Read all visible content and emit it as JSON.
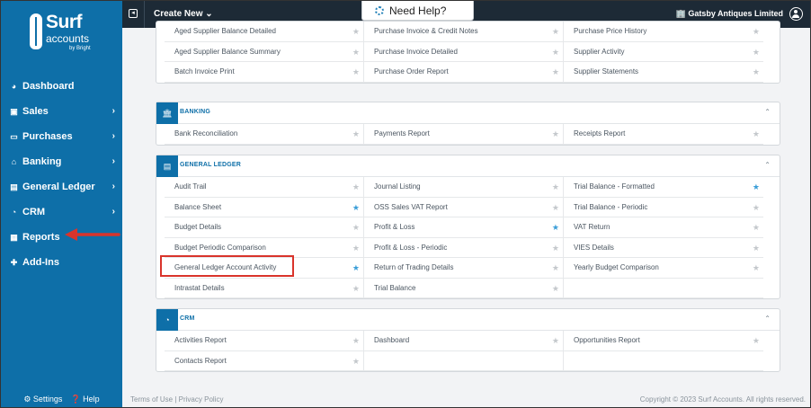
{
  "sidebar": {
    "logo": {
      "line1": "Surf",
      "line2": "accounts",
      "line3": "by Bright"
    },
    "items": [
      {
        "label": "Dashboard",
        "icon": "dashboard-icon",
        "glyph": "◕",
        "chevron": ""
      },
      {
        "label": "Sales",
        "icon": "briefcase-icon",
        "glyph": "▣",
        "chevron": "›"
      },
      {
        "label": "Purchases",
        "icon": "card-icon",
        "glyph": "▭",
        "chevron": "›"
      },
      {
        "label": "Banking",
        "icon": "bank-icon",
        "glyph": "⌂",
        "chevron": "›"
      },
      {
        "label": "General Ledger",
        "icon": "ledger-icon",
        "glyph": "▤",
        "chevron": "›"
      },
      {
        "label": "CRM",
        "icon": "pie-chart-icon",
        "glyph": "◔",
        "chevron": "›"
      },
      {
        "label": "Reports",
        "icon": "table-icon",
        "glyph": "▦",
        "chevron": ""
      },
      {
        "label": "Add-Ins",
        "icon": "puzzle-icon",
        "glyph": "✚",
        "chevron": ""
      }
    ],
    "settings_label": "⚙ Settings",
    "help_label": "❓ Help"
  },
  "topbar": {
    "create_label": "Create New ⌄",
    "help_label": "Need Help?",
    "company": "🏢 Gatsby Antiques Limited"
  },
  "top_rows": [
    {
      "label": "Aged Supplier Balance Detailed",
      "starred": false
    },
    {
      "label": "Purchase Invoice & Credit Notes",
      "starred": false
    },
    {
      "label": "Purchase Price History",
      "starred": false
    },
    {
      "label": "Aged Supplier Balance Summary",
      "starred": false
    },
    {
      "label": "Purchase Invoice Detailed",
      "starred": false
    },
    {
      "label": "Supplier Activity",
      "starred": false
    },
    {
      "label": "Batch Invoice Print",
      "starred": false
    },
    {
      "label": "Purchase Order Report",
      "starred": false
    },
    {
      "label": "Supplier Statements",
      "starred": false
    }
  ],
  "banking": {
    "title": "BANKING",
    "rows": [
      {
        "label": "Bank Reconciliation",
        "starred": false
      },
      {
        "label": "Payments Report",
        "starred": false
      },
      {
        "label": "Receipts Report",
        "starred": false
      }
    ]
  },
  "general_ledger": {
    "title": "GENERAL LEDGER",
    "rows": [
      {
        "label": "Audit Trail",
        "starred": false
      },
      {
        "label": "Journal Listing",
        "starred": false
      },
      {
        "label": "Trial Balance - Formatted",
        "starred": true
      },
      {
        "label": "Balance Sheet",
        "starred": true
      },
      {
        "label": "OSS Sales VAT Report",
        "starred": false
      },
      {
        "label": "Trial Balance - Periodic",
        "starred": false
      },
      {
        "label": "Budget Details",
        "starred": false
      },
      {
        "label": "Profit & Loss",
        "starred": true
      },
      {
        "label": "VAT Return",
        "starred": false
      },
      {
        "label": "Budget Periodic Comparison",
        "starred": false
      },
      {
        "label": "Profit & Loss - Periodic",
        "starred": false
      },
      {
        "label": "VIES Details",
        "starred": false
      },
      {
        "label": "General Ledger Account Activity",
        "starred": true
      },
      {
        "label": "Return of Trading Details",
        "starred": false
      },
      {
        "label": "Yearly Budget Comparison",
        "starred": false
      },
      {
        "label": "Intrastat Details",
        "starred": false
      },
      {
        "label": "Trial Balance",
        "starred": false
      }
    ]
  },
  "crm": {
    "title": "CRM",
    "rows": [
      {
        "label": "Activities Report",
        "starred": false
      },
      {
        "label": "Dashboard",
        "starred": false
      },
      {
        "label": "Opportunities Report",
        "starred": false
      },
      {
        "label": "Contacts Report",
        "starred": false
      }
    ]
  },
  "footer": {
    "terms": "Terms of Use",
    "separator": " | ",
    "privacy": "Privacy Policy",
    "copyright": "Copyright © 2023 Surf Accounts. All rights reserved."
  },
  "colors": {
    "brand": "#0e6fa8",
    "topbar": "#1d2a36",
    "star_on": "#3b9ed8",
    "annotation": "#d9342b"
  }
}
